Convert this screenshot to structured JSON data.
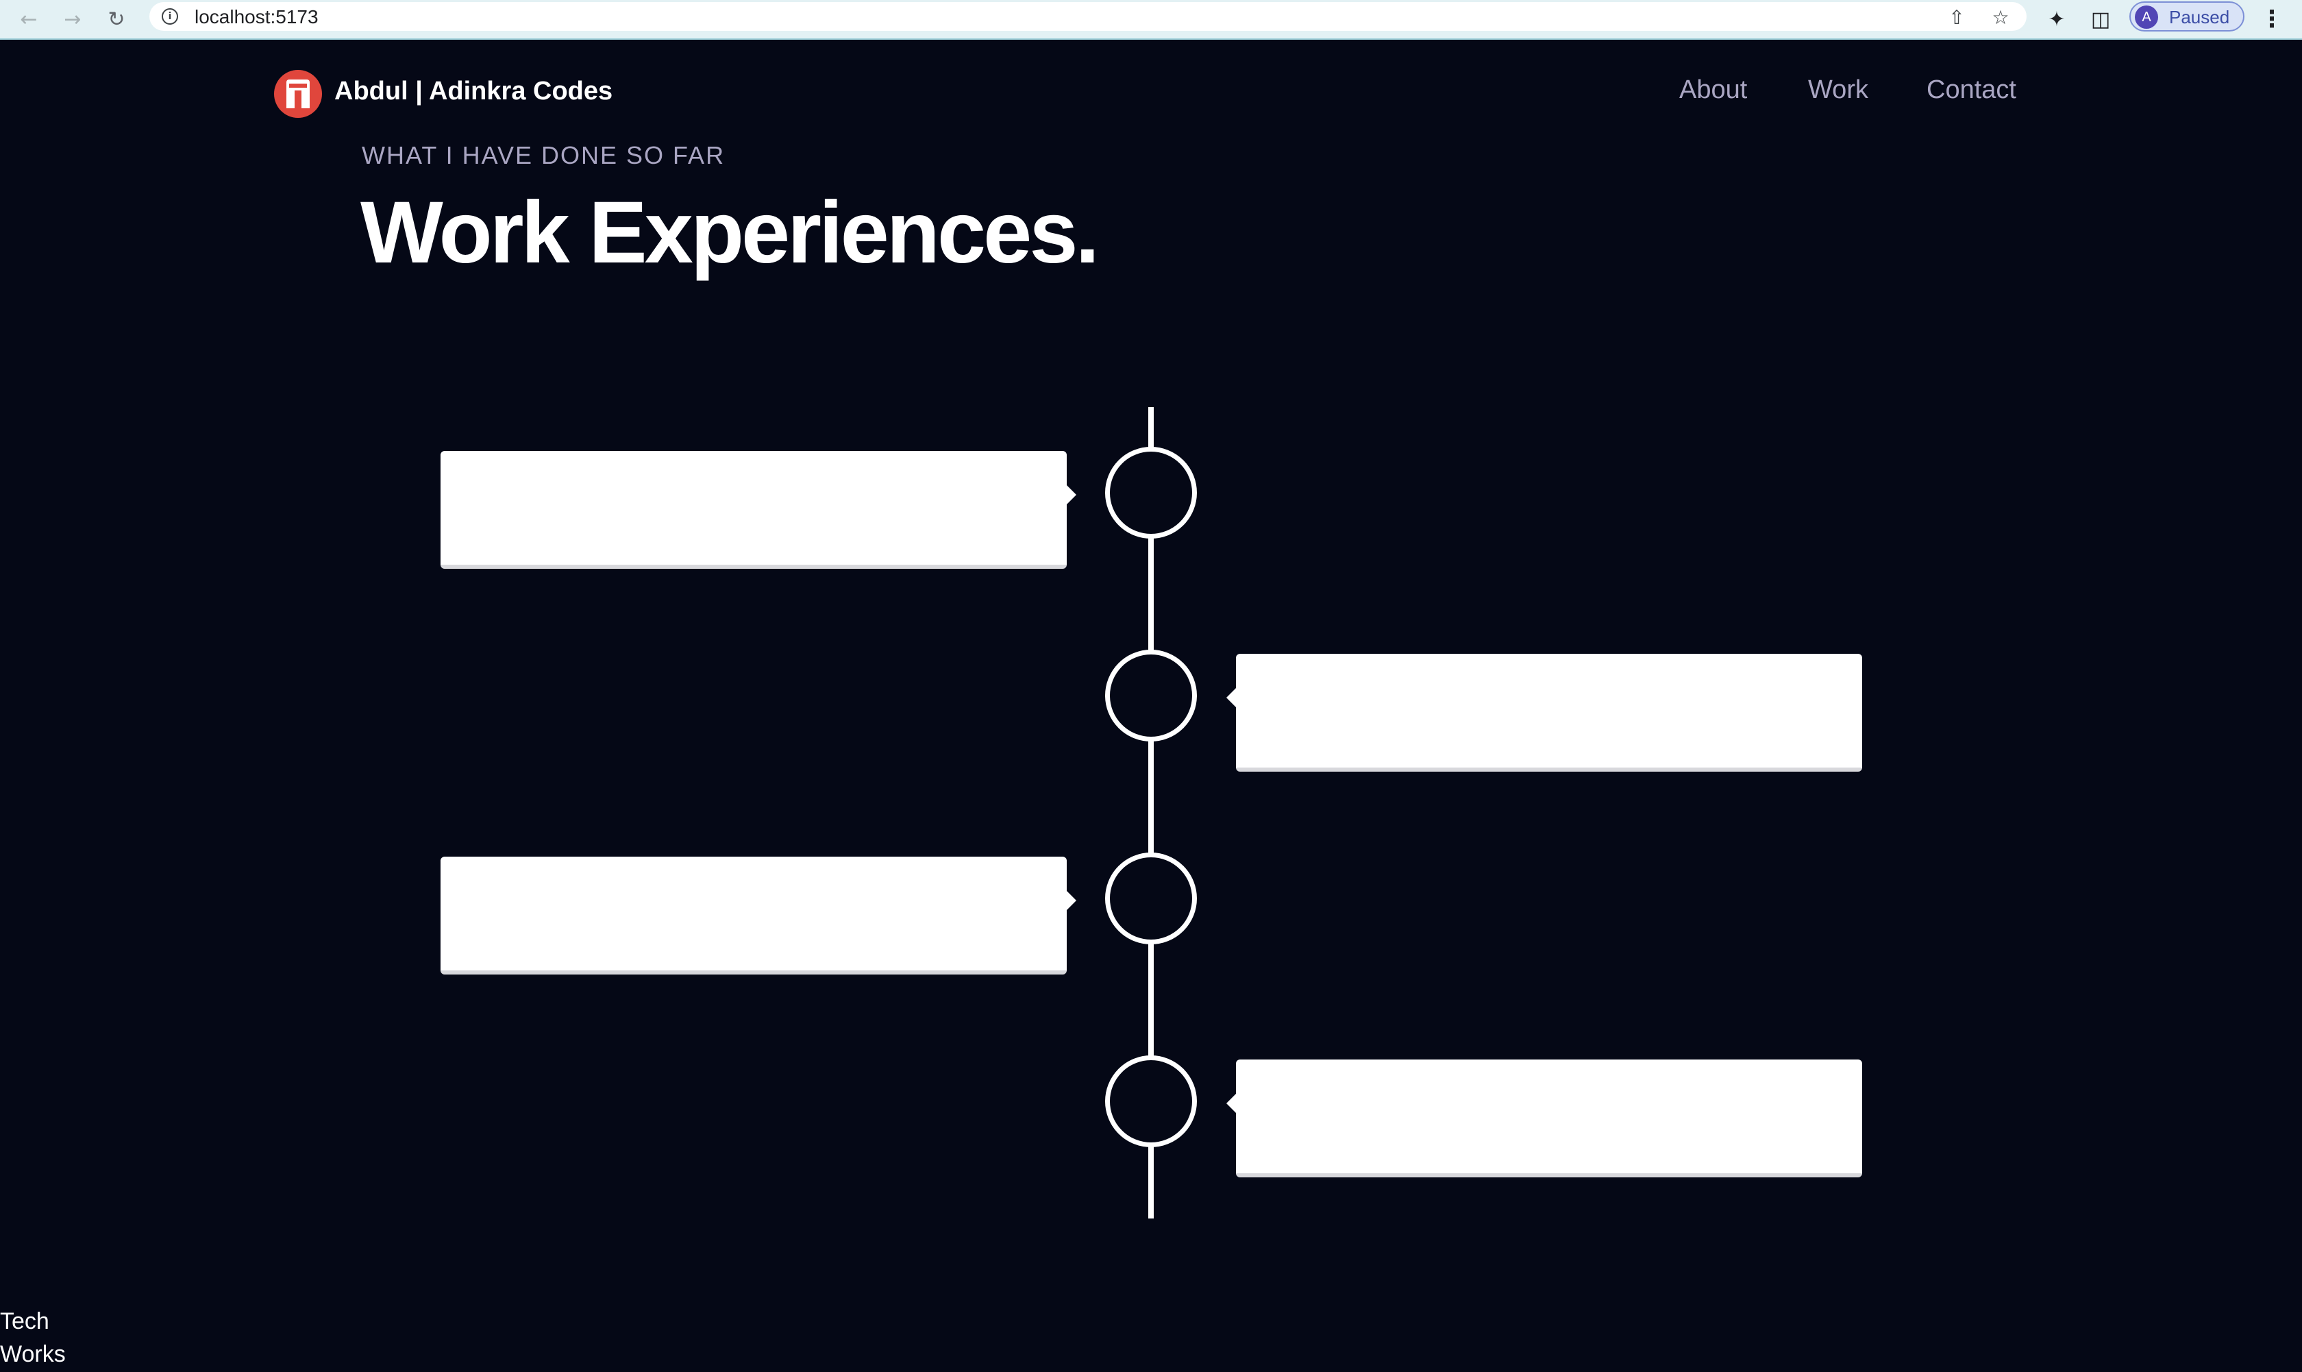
{
  "browser": {
    "url": "localhost:5173",
    "profile_initial": "A",
    "profile_status": "Paused",
    "icons": [
      "back-arrow-icon",
      "forward-arrow-icon",
      "reload-icon",
      "info-icon",
      "share-icon",
      "star-icon",
      "extensions-icon",
      "sidepanel-icon",
      "menu-icon"
    ]
  },
  "nav": {
    "brand": "Abdul  | Adinkra Codes",
    "links": [
      "About",
      "Work",
      "Contact"
    ]
  },
  "section": {
    "subtitle": "WHAT I HAVE DONE SO FAR",
    "title": "Work Experiences."
  },
  "timeline": {
    "items": [
      {
        "side": "left"
      },
      {
        "side": "right"
      },
      {
        "side": "left"
      },
      {
        "side": "right"
      }
    ]
  },
  "footer": {
    "line1": "Tech",
    "line2": "Works"
  },
  "colors": {
    "background": "#050816",
    "secondary_text": "#aaa6c3",
    "accent": "#e0463c",
    "chrome": "#e3f1f4"
  }
}
